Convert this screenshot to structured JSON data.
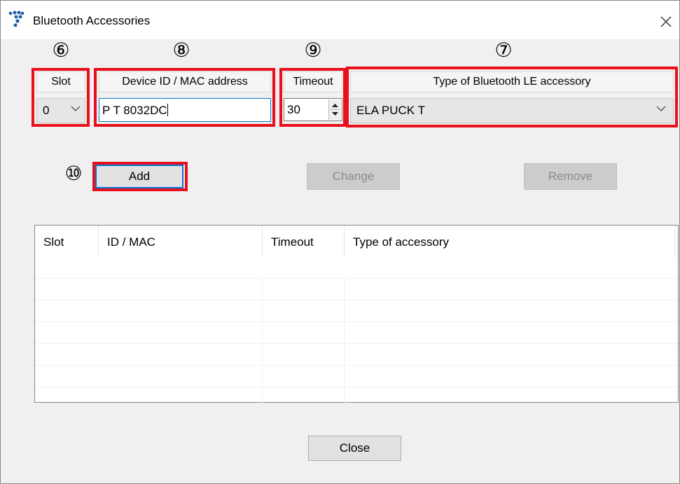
{
  "window": {
    "title": "Bluetooth Accessories",
    "close_glyph": "×"
  },
  "callouts": {
    "slot": "⑥",
    "device_id": "⑧",
    "timeout": "⑨",
    "type": "⑦",
    "add": "⑩"
  },
  "form": {
    "slot_header": "Slot",
    "slot_value": "0",
    "device_id_header": "Device ID / MAC address",
    "device_id_value": "P T 8032DC",
    "timeout_header": "Timeout",
    "timeout_value": "30",
    "type_header": "Type of Bluetooth LE accessory",
    "type_value": "ELA PUCK T"
  },
  "buttons": {
    "add": "Add",
    "change": "Change",
    "remove": "Remove",
    "close": "Close"
  },
  "button_states": {
    "change_enabled": false,
    "remove_enabled": false
  },
  "list": {
    "columns": [
      "Slot",
      "ID / MAC",
      "Timeout",
      "Type of accessory"
    ],
    "rows": []
  },
  "colors": {
    "highlight_box": "#e8101c",
    "focus_border": "#0078d7",
    "dialog_background": "#f0f0f0",
    "app_icon": "#1f5fa8"
  },
  "icons": {
    "app": "bluetooth-dots-icon",
    "close": "close-icon",
    "dropdown": "chevron-down-icon",
    "spinner": "spin-up-down-icon"
  }
}
